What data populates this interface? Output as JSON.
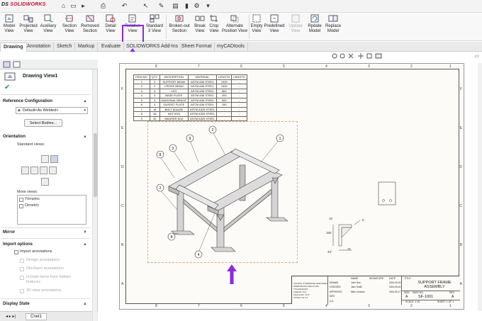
{
  "app": {
    "brand_ds": "DS",
    "brand": "SOLIDWORKS"
  },
  "ribbon": {
    "buttons": [
      {
        "label": "Model\nView",
        "name": "model-view"
      },
      {
        "label": "Projected\nView",
        "name": "projected-view"
      },
      {
        "label": "Auxiliary\nView",
        "name": "auxiliary-view"
      },
      {
        "label": "Section\nView",
        "name": "section-view"
      },
      {
        "label": "Removed\nSection",
        "name": "removed-section"
      },
      {
        "label": "Detail\nView",
        "name": "detail-view"
      },
      {
        "label": "Relative\nView",
        "name": "relative-view"
      },
      {
        "label": "Standard\n3 View",
        "name": "standard-3-view"
      },
      {
        "label": "Broken-out\nSection",
        "name": "broken-out-section"
      },
      {
        "label": "Break\nView",
        "name": "break-view"
      },
      {
        "label": "Crop\nView",
        "name": "crop-view"
      },
      {
        "label": "Alternate\nPosition View",
        "name": "alternate-position-view"
      },
      {
        "label": "Empty\nView",
        "name": "empty-view"
      },
      {
        "label": "Predefined\nView",
        "name": "predefined-view"
      },
      {
        "label": "Update\nView",
        "name": "update-view"
      },
      {
        "label": "Replace\nModel",
        "name": "replace-model"
      }
    ]
  },
  "tabs": [
    "Drawing",
    "Annotation",
    "Sketch",
    "Markup",
    "Evaluate",
    "SOLIDWORKS Add-Ins",
    "Sheet Format",
    "myCADtools"
  ],
  "panel": {
    "title": "Drawing View1",
    "ref_config": "Reference Configuration",
    "config_value": "Default<As Welded>",
    "select_bodies": "Select Bodies...",
    "orientation": "Orientation",
    "standard_views": "Standard views:",
    "more_views": "More views:",
    "trimetric": "Trimetric",
    "dimetric": "Dimetric",
    "mirror": "Mirror",
    "import_options": "Import options",
    "import_annotations": "Import annotations",
    "design_annotations": "Design annotations",
    "dimxpert": "DimXpert annotations",
    "include_hidden": "Include items from hidden",
    "features": "features",
    "view3d": "3D view annotations",
    "display_state": "Display State",
    "bottom_tab": "Cnet1"
  },
  "bom": {
    "headers": [
      "ITEM NO.",
      "QTY.",
      "DESCRIPTION",
      "MATERIAL",
      "LENGTH",
      "LENGTH"
    ],
    "rows": [
      [
        "1",
        "2",
        "SUPPORT BEAM",
        "ASTM A36 STEEL",
        "1200",
        "-"
      ],
      [
        "2",
        "2",
        "CROSS BEAM",
        "ASTM A36 STEEL",
        "1000",
        "-"
      ],
      [
        "3",
        "4",
        "LEG",
        "ASTM A36 STEEL",
        "800",
        "-"
      ],
      [
        "4",
        "4",
        "BASE PLATE",
        "ASTM A36 STEEL",
        "200",
        "-"
      ],
      [
        "5",
        "4",
        "DIAGONAL BRACE",
        "ASTM A36 STEEL",
        "600",
        "-"
      ],
      [
        "6",
        "4",
        "GUSSET PLATE",
        "ASTM A36 STEEL",
        "150",
        "-"
      ],
      [
        "7",
        "16",
        "BOLT M16x50",
        "ASTM A325 STEEL",
        "-",
        "-"
      ],
      [
        "8",
        "16",
        "NUT M16",
        "ASTM A325 STEEL",
        "-",
        "-"
      ],
      [
        "9",
        "32",
        "WASHER M16",
        "ASTM A325 STEEL",
        "-",
        "-"
      ]
    ]
  },
  "zones": {
    "top": [
      "8",
      "7",
      "6",
      "5",
      "4",
      "3",
      "2",
      "1"
    ],
    "left": [
      "F",
      "E",
      "D",
      "C",
      "B",
      "A"
    ]
  },
  "balloons": [
    "2",
    "1",
    "9",
    "3",
    "8",
    "2",
    "8",
    "4"
  ],
  "dims": {
    "d10": "10",
    "d6": "6",
    "d150": "150",
    "d45": "45°",
    "d71": "71"
  },
  "titleblock": {
    "title_label": "TITLE:",
    "title": "SUPPORT FRAME\nASSEMBLY",
    "dwg_label": "DWG NO.",
    "dwg": "SF-1001",
    "rev_label": "REV",
    "rev": "A",
    "size_label": "SIZE",
    "size": "A",
    "scale": "SCALE: 1:10",
    "sheet": "SHEET 1 OF 1",
    "name_label": "NAME",
    "sig_label": "SIGNATURE",
    "date_label": "DATE",
    "rows": [
      [
        "DRAWN",
        "John Doe",
        "2024-05-15"
      ],
      [
        "CHECKED",
        "Jane Smith",
        "2024-05-16"
      ],
      [
        "APPROVED",
        "Mike Johnson",
        "2024-05-17"
      ],
      [
        "MFG",
        "",
        ""
      ],
      [
        "Q.A",
        "",
        ""
      ]
    ],
    "notes": "UNLESS OTHERWISE SPECIFIED:\nDIMENSIONS ARE IN MM\nTOLERANCES:\nLINEAR: ±0.5\nANGULAR: ±0.5°\nFINISH: Ra 3.2"
  },
  "colors": {
    "accent": "#8a2be2",
    "brand": "#c8102e"
  }
}
